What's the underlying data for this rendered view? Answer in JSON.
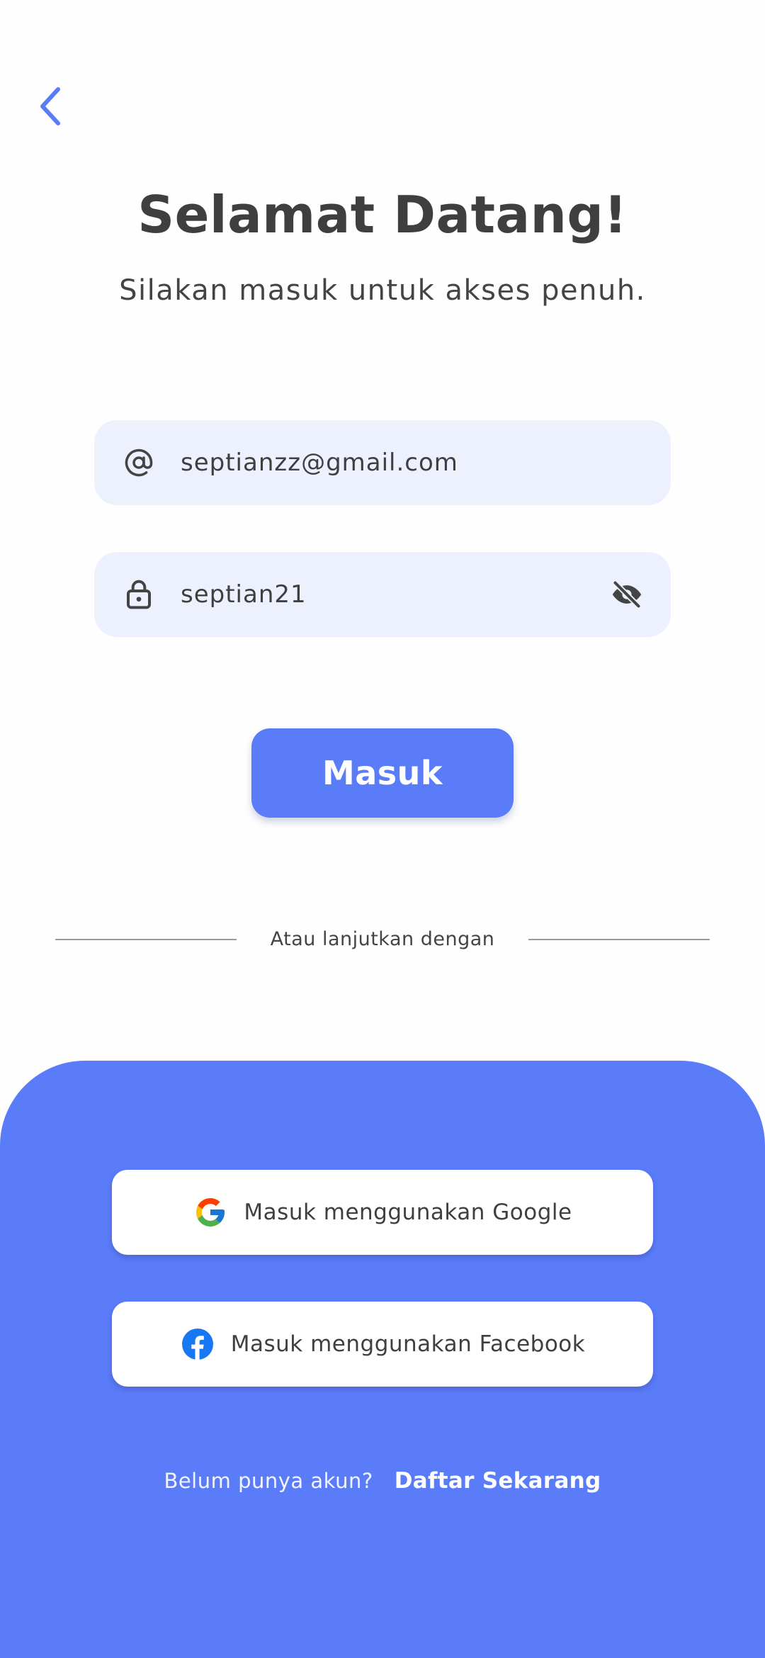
{
  "header": {
    "title": "Selamat Datang!",
    "subtitle": "Silakan masuk untuk akses penuh."
  },
  "form": {
    "email": {
      "value": "septianzz@gmail.com",
      "icon": "at-icon"
    },
    "password": {
      "value": "septian21",
      "icon": "lock-icon",
      "toggle_icon": "eye-off-icon"
    },
    "submit_label": "Masuk"
  },
  "divider": {
    "text": "Atau lanjutkan dengan"
  },
  "social": {
    "google_label": "Masuk menggunakan Google",
    "facebook_label": "Masuk menggunakan Facebook"
  },
  "signup": {
    "prompt": "Belum punya akun?",
    "link": "Daftar Sekarang"
  },
  "colors": {
    "accent": "#5B7CF9",
    "field_bg": "#EDF1FD",
    "text": "#3F3F3F",
    "background": "#FEFEFE"
  }
}
